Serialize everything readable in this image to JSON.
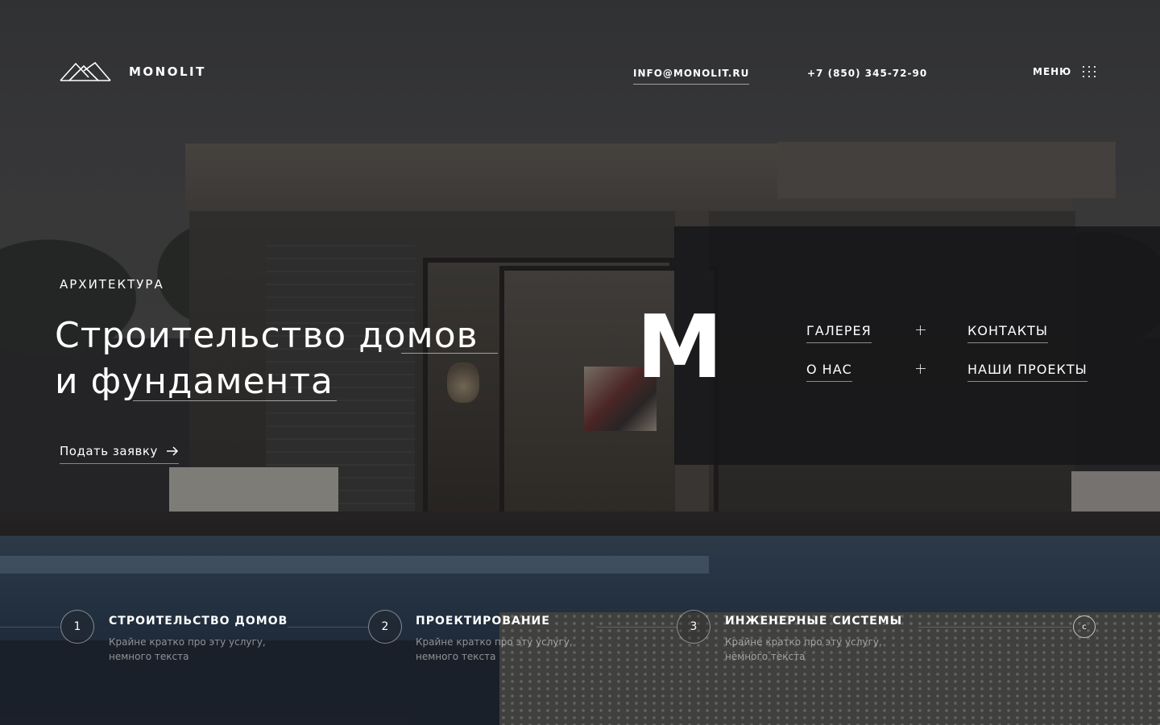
{
  "brand": {
    "name": "MONOLIT",
    "logo_icon": "mountain-logo-icon"
  },
  "header": {
    "email": "INFO@MONOLIT.RU",
    "phone": "+7 (850) 345-72-90",
    "menu_label": "МЕНЮ",
    "menu_icon": "dots-grid-icon"
  },
  "hero": {
    "eyebrow": "АРХИТЕКТУРА",
    "title_line1": "Строительство домов",
    "title_line2": "и фундамента",
    "cta_label": "Подать заявку",
    "cta_icon": "arrow-right-icon"
  },
  "panel": {
    "letter": "M",
    "links": [
      {
        "label": "ГАЛЕРЕЯ",
        "expandable": true
      },
      {
        "label": "КОНТАКТЫ",
        "expandable": false
      },
      {
        "label": "О НАС",
        "expandable": true
      },
      {
        "label": "НАШИ ПРОЕКТЫ",
        "expandable": false
      }
    ]
  },
  "services": [
    {
      "number": "1",
      "title": "СТРОИТЕЛЬСТВО ДОМОВ",
      "description": "Крайне кратко про эту услугу, немного текста"
    },
    {
      "number": "2",
      "title": "ПРОЕКТИРОВАНИЕ",
      "description": "Крайне кратко про эту услугу, немного текста"
    },
    {
      "number": "3",
      "title": "ИНЖЕНЕРНЫЕ СИСТЕМЫ",
      "description": "Крайне кратко про эту услугу, немного текста"
    }
  ],
  "next_button": {
    "label": "c"
  }
}
